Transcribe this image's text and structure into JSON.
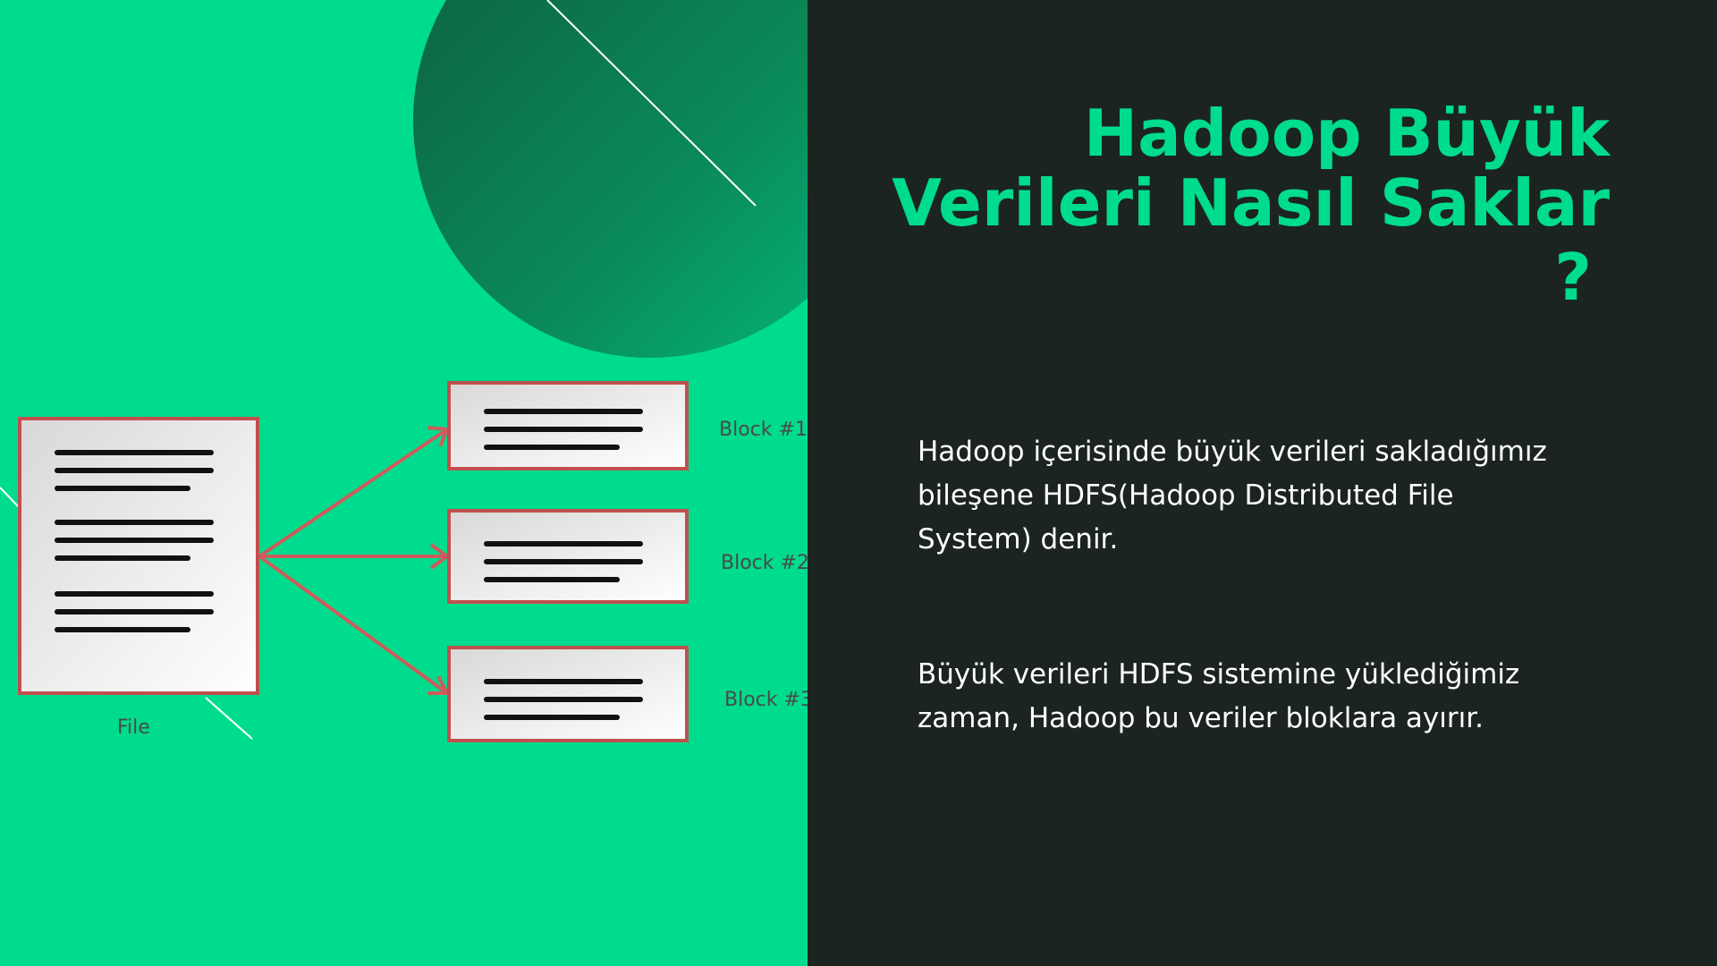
{
  "slide": {
    "title": "Hadoop Büyük Verileri Nasıl Saklar",
    "title_mark": "?",
    "paragraphs": [
      "Hadoop içerisinde büyük verileri sakladığımız bileşene HDFS(Hadoop Distributed File System) denir.",
      "Büyük verileri HDFS sistemine yüklediğimiz zaman, Hadoop bu veriler bloklara ayırır."
    ]
  },
  "diagram": {
    "file_label": "File",
    "blocks": [
      "Block #1",
      "Block #2",
      "Block #3"
    ]
  },
  "colors": {
    "accent_green": "#00dc8d",
    "dark_background": "#1b2421",
    "circle_green": "#0b6e4a",
    "arrow_red": "#cd5c5c"
  }
}
